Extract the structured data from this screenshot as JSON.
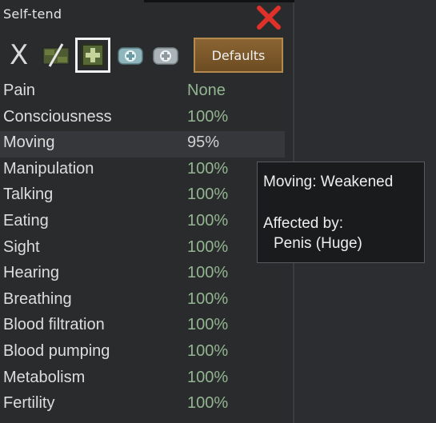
{
  "window": {
    "title": "Self-tend"
  },
  "toolbar": {
    "clear_label": "X",
    "defaults_label": "Defaults"
  },
  "icons": {
    "close": "close-icon",
    "no_care": "no-care-icon",
    "basic": "basic-care-icon",
    "medicine": "medicine-icon",
    "best": "best-medicine-icon"
  },
  "stats": [
    {
      "label": "Pain",
      "value": "None"
    },
    {
      "label": "Consciousness",
      "value": "100%"
    },
    {
      "label": "Moving",
      "value": "95%"
    },
    {
      "label": "Manipulation",
      "value": "100%"
    },
    {
      "label": "Talking",
      "value": "100%"
    },
    {
      "label": "Eating",
      "value": "100%"
    },
    {
      "label": "Sight",
      "value": "100%"
    },
    {
      "label": "Hearing",
      "value": "100%"
    },
    {
      "label": "Breathing",
      "value": "100%"
    },
    {
      "label": "Blood filtration",
      "value": "100%"
    },
    {
      "label": "Blood pumping",
      "value": "100%"
    },
    {
      "label": "Metabolism",
      "value": "100%"
    },
    {
      "label": "Fertility",
      "value": "100%"
    }
  ],
  "tooltip": {
    "line1": "Moving: Weakened",
    "line2": "Affected by:",
    "line3": "Penis (Huge)"
  },
  "colors": {
    "value_green": "#93b592",
    "close_red": "#e0302a",
    "defaults_button": "#7b5a2c"
  }
}
